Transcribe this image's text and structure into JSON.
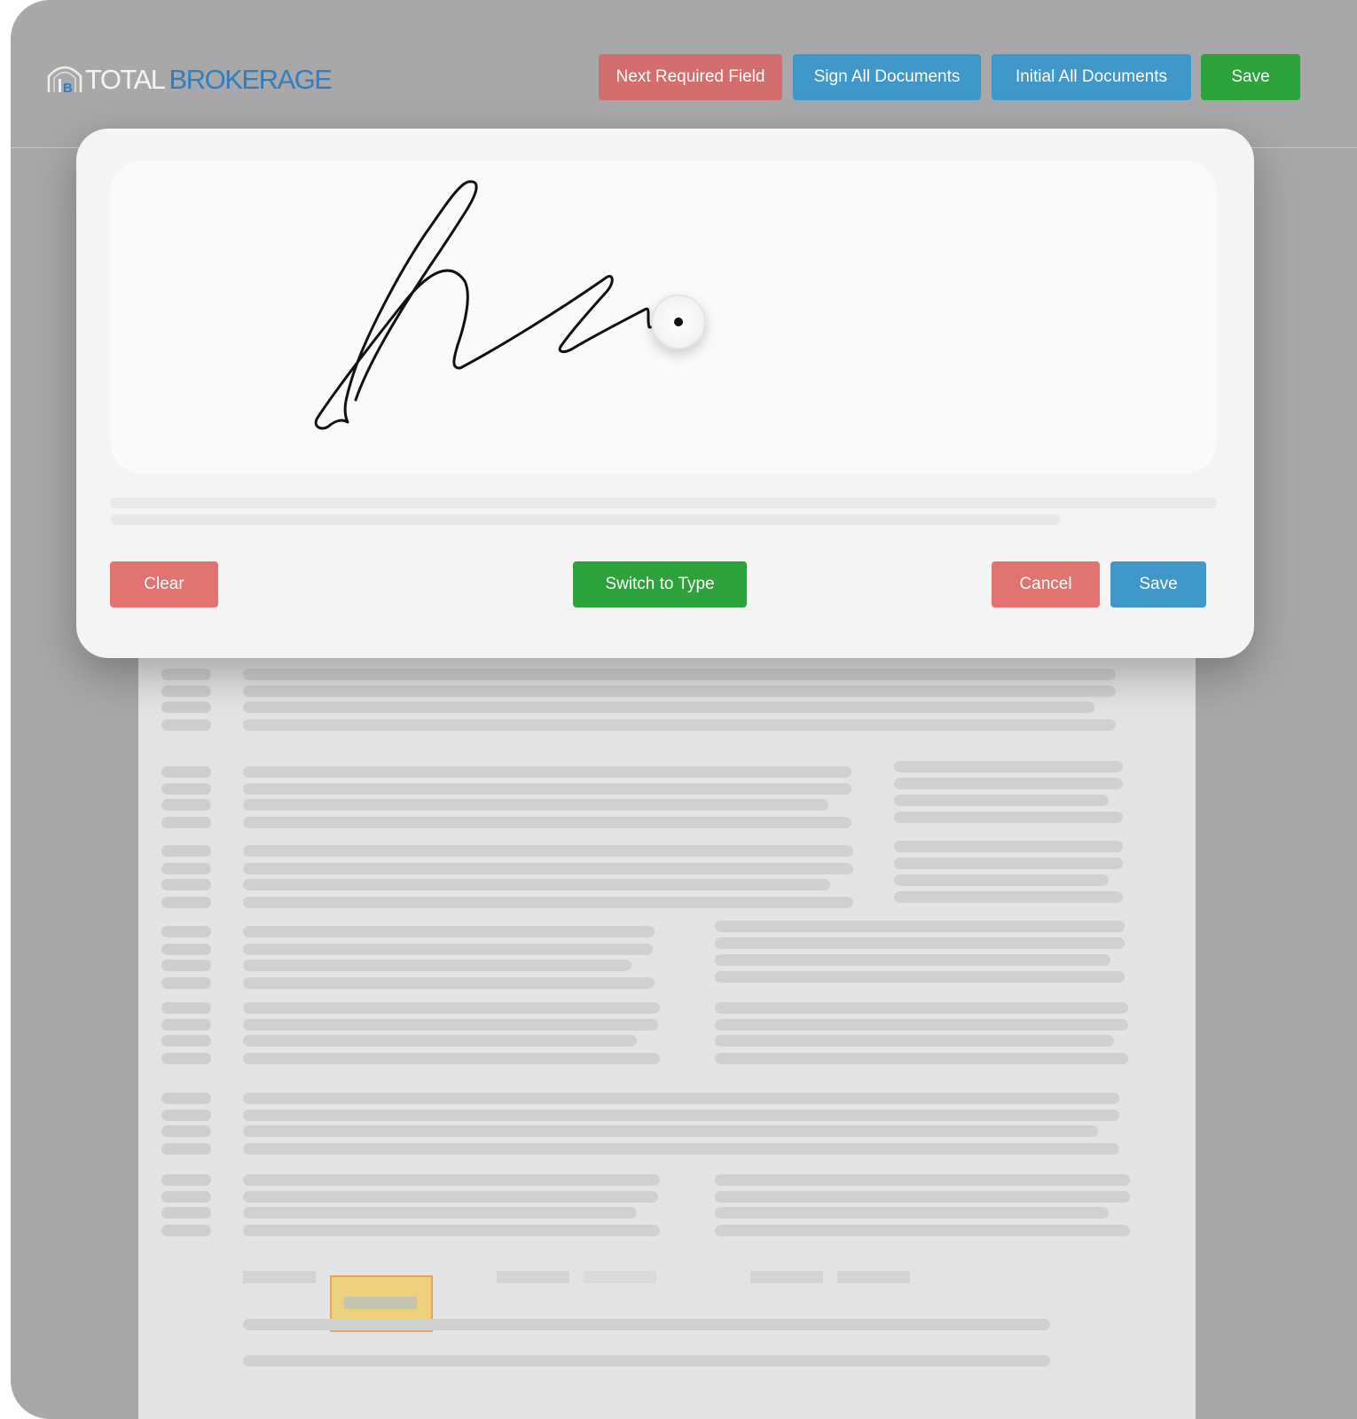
{
  "brand": {
    "name_part1": "TOTAL",
    "name_part2": "BROKERAGE",
    "icon": "house-tb-logo-icon",
    "accent_color": "#2f7fbf"
  },
  "toolbar": {
    "next_required_field": "Next Required Field",
    "sign_all_documents": "Sign All Documents",
    "initial_all_documents": "Initial All Documents",
    "save": "Save"
  },
  "signature_modal": {
    "clear": "Clear",
    "switch_to_type": "Switch to Type",
    "cancel": "Cancel",
    "save": "Save"
  },
  "colors": {
    "red": "#d46e6c",
    "blue": "#3f98c9",
    "green": "#2ca23b",
    "highlight_field": "#ecd07c"
  }
}
